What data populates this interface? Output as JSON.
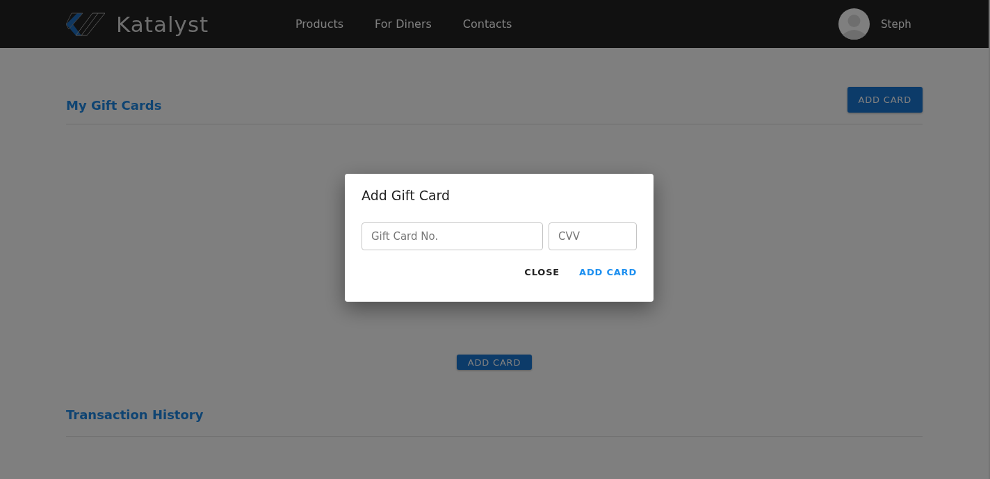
{
  "header": {
    "brand": "Katalyst",
    "nav": [
      "Products",
      "For Diners",
      "Contacts"
    ],
    "user": "Steph"
  },
  "gift_cards": {
    "title": "My Gift Cards",
    "add_button": "ADD CARD",
    "empty_button": "ADD CARD"
  },
  "transactions": {
    "title": "Transaction History"
  },
  "dialog": {
    "title": "Add Gift Card",
    "fields": [
      {
        "placeholder": "Gift Card No."
      },
      {
        "placeholder": "CVV"
      }
    ],
    "buttons": [
      {
        "label": "CLOSE",
        "kind": "secondary"
      },
      {
        "label": "ADD CARD",
        "kind": "primary"
      }
    ]
  }
}
